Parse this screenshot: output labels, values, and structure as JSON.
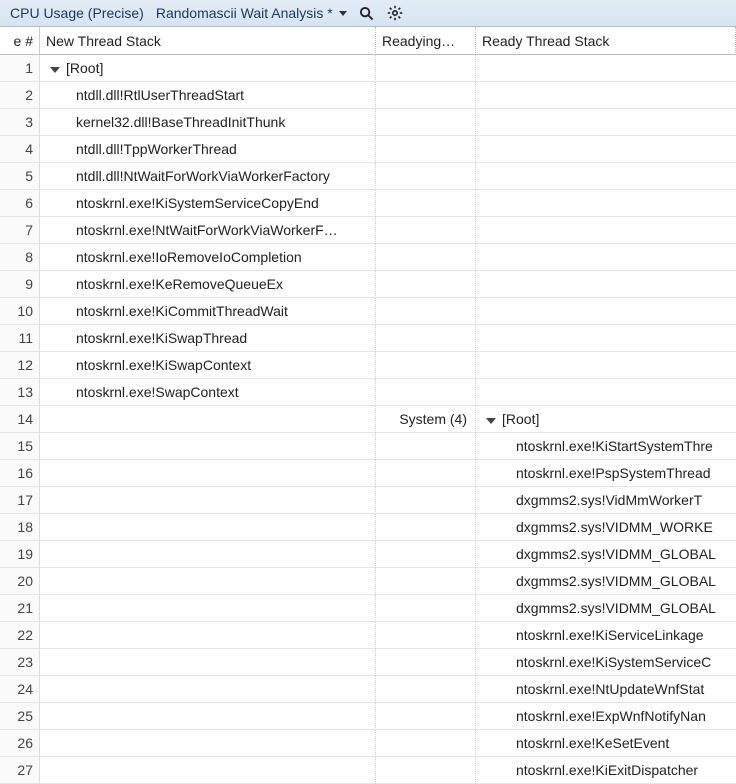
{
  "titlebar": {
    "title": "CPU Usage (Precise)",
    "preset": "Randomascii Wait Analysis *"
  },
  "columns": {
    "line": "e #",
    "newstack": "New Thread Stack",
    "readying": "Readying…",
    "readystack": "Ready Thread Stack"
  },
  "rows": [
    {
      "n": "1",
      "new": "[Root]",
      "newCaret": true,
      "ready": "",
      "readying": ""
    },
    {
      "n": "2",
      "new": "ntdll.dll!RtlUserThreadStart",
      "ready": "",
      "readying": ""
    },
    {
      "n": "3",
      "new": "kernel32.dll!BaseThreadInitThunk",
      "ready": "",
      "readying": ""
    },
    {
      "n": "4",
      "new": "ntdll.dll!TppWorkerThread",
      "ready": "",
      "readying": ""
    },
    {
      "n": "5",
      "new": "ntdll.dll!NtWaitForWorkViaWorkerFactory",
      "ready": "",
      "readying": ""
    },
    {
      "n": "6",
      "new": "ntoskrnl.exe!KiSystemServiceCopyEnd",
      "ready": "",
      "readying": ""
    },
    {
      "n": "7",
      "new": "ntoskrnl.exe!NtWaitForWorkViaWorkerF…",
      "ready": "",
      "readying": ""
    },
    {
      "n": "8",
      "new": "ntoskrnl.exe!IoRemoveIoCompletion",
      "ready": "",
      "readying": ""
    },
    {
      "n": "9",
      "new": "ntoskrnl.exe!KeRemoveQueueEx",
      "ready": "",
      "readying": ""
    },
    {
      "n": "10",
      "new": "ntoskrnl.exe!KiCommitThreadWait",
      "ready": "",
      "readying": ""
    },
    {
      "n": "11",
      "new": "ntoskrnl.exe!KiSwapThread",
      "ready": "",
      "readying": ""
    },
    {
      "n": "12",
      "new": "ntoskrnl.exe!KiSwapContext",
      "ready": "",
      "readying": ""
    },
    {
      "n": "13",
      "new": "ntoskrnl.exe!SwapContext",
      "ready": "",
      "readying": ""
    },
    {
      "n": "14",
      "new": "",
      "ready": "[Root]",
      "readyCaret": true,
      "readying": "System (4)"
    },
    {
      "n": "15",
      "new": "",
      "ready": "ntoskrnl.exe!KiStartSystemThre",
      "readying": ""
    },
    {
      "n": "16",
      "new": "",
      "ready": "ntoskrnl.exe!PspSystemThread",
      "readying": ""
    },
    {
      "n": "17",
      "new": "",
      "ready": "dxgmms2.sys!VidMmWorkerT",
      "readying": ""
    },
    {
      "n": "18",
      "new": "",
      "ready": "dxgmms2.sys!VIDMM_WORKE",
      "readying": ""
    },
    {
      "n": "19",
      "new": "",
      "ready": "dxgmms2.sys!VIDMM_GLOBAL",
      "readying": ""
    },
    {
      "n": "20",
      "new": "",
      "ready": "dxgmms2.sys!VIDMM_GLOBAL",
      "readying": ""
    },
    {
      "n": "21",
      "new": "",
      "ready": "dxgmms2.sys!VIDMM_GLOBAL",
      "readying": ""
    },
    {
      "n": "22",
      "new": "",
      "ready": "ntoskrnl.exe!KiServiceLinkage",
      "readying": ""
    },
    {
      "n": "23",
      "new": "",
      "ready": "ntoskrnl.exe!KiSystemServiceC",
      "readying": ""
    },
    {
      "n": "24",
      "new": "",
      "ready": "ntoskrnl.exe!NtUpdateWnfStat",
      "readying": ""
    },
    {
      "n": "25",
      "new": "",
      "ready": "ntoskrnl.exe!ExpWnfNotifyNan",
      "readying": ""
    },
    {
      "n": "26",
      "new": "",
      "ready": "ntoskrnl.exe!KeSetEvent",
      "readying": ""
    },
    {
      "n": "27",
      "new": "",
      "ready": "ntoskrnl.exe!KiExitDispatcher",
      "readying": ""
    }
  ]
}
